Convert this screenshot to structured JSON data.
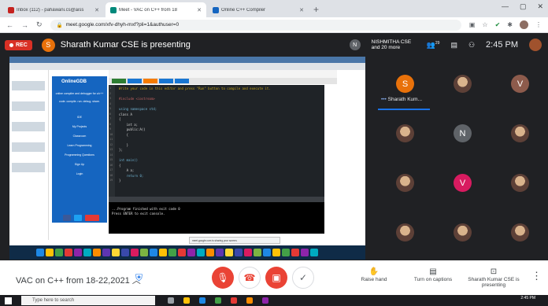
{
  "browser": {
    "tabs": [
      {
        "title": "Inbox (112) - pahawani.cs@aiss",
        "favicon_color": "#c5221f",
        "active": false
      },
      {
        "title": "Meet - VAC on C++ from 18",
        "favicon_color": "#00897b",
        "active": true
      },
      {
        "title": "Online C++ Compiler",
        "favicon_color": "#1565c0",
        "active": false
      }
    ],
    "url": "meet.google.com/xfv-dhyh-mxf?pli=1&authuser=0"
  },
  "meet": {
    "rec_label": "REC",
    "presenter_initial": "S",
    "presenter_text": "Sharath Kumar CSE is presenting",
    "other_initial": "N",
    "other_names": "NISHMITHA CSE and 20 more",
    "participant_count": "29",
    "time": "2:45 PM",
    "meeting_title": "VAC on C++ from 18-22,2021",
    "actions": [
      {
        "label": "Raise hand",
        "glyph": "✋"
      },
      {
        "label": "Turn on captions",
        "glyph": "▤"
      },
      {
        "label": "Sharath Kumar CSE is presenting",
        "glyph": "⊡"
      }
    ]
  },
  "participants": [
    {
      "initial": "S",
      "color": "#e8710a",
      "photo": false
    },
    {
      "initial": "",
      "color": "#8d6e63",
      "photo": true
    },
    {
      "initial": "V",
      "color": "#8d5b4c",
      "photo": false
    },
    {
      "initial": "",
      "color": "#8d6e63",
      "photo": true
    },
    {
      "initial": "N",
      "color": "#5f6368",
      "photo": false
    },
    {
      "initial": "",
      "color": "#8d6e63",
      "photo": true
    },
    {
      "initial": "",
      "color": "#8d6e63",
      "photo": true
    },
    {
      "initial": "V",
      "color": "#d81b60",
      "photo": false
    },
    {
      "initial": "",
      "color": "#8d6e63",
      "photo": true
    },
    {
      "initial": "",
      "color": "#8d6e63",
      "photo": true
    },
    {
      "initial": "",
      "color": "#8d6e63",
      "photo": true
    },
    {
      "initial": "",
      "color": "#8d6e63",
      "photo": true
    }
  ],
  "speaker_label": "Sharath Kum...",
  "shared": {
    "brand": "OnlineGDB",
    "side_items": [
      "online compiler and debugger for c/c++",
      "code. compile. run. debug. share.",
      "IDE",
      "My Projects",
      "Classroom",
      "Learn Programming",
      "Programming Questions",
      "Sign Up",
      "Login"
    ],
    "code_lines": [
      {
        "text": "Write your code in this editor and press \"Run\" button to compile and execute it.",
        "cls": "cmt"
      },
      {
        "text": "",
        "cls": ""
      },
      {
        "text": "#include <iostream>",
        "cls": "inc"
      },
      {
        "text": "",
        "cls": ""
      },
      {
        "text": "using namespace std;",
        "cls": "kw"
      },
      {
        "text": "class A",
        "cls": ""
      },
      {
        "text": "{",
        "cls": ""
      },
      {
        "text": "    int a;",
        "cls": ""
      },
      {
        "text": "    public:A()",
        "cls": ""
      },
      {
        "text": "    {",
        "cls": ""
      },
      {
        "text": "",
        "cls": ""
      },
      {
        "text": "    }",
        "cls": ""
      },
      {
        "text": "};",
        "cls": ""
      },
      {
        "text": "",
        "cls": ""
      },
      {
        "text": "int main()",
        "cls": "kw"
      },
      {
        "text": "{",
        "cls": ""
      },
      {
        "text": "    A a;",
        "cls": ""
      },
      {
        "text": "    return 0;",
        "cls": "kw"
      },
      {
        "text": "}",
        "cls": ""
      }
    ],
    "console_lines": [
      "...Program finished with exit code 0",
      "Press ENTER to exit console."
    ],
    "share_notice": "meet.google.com is sharing your screen."
  },
  "windows": {
    "search_placeholder": "Type here to search",
    "clock": "2:45 PM"
  }
}
